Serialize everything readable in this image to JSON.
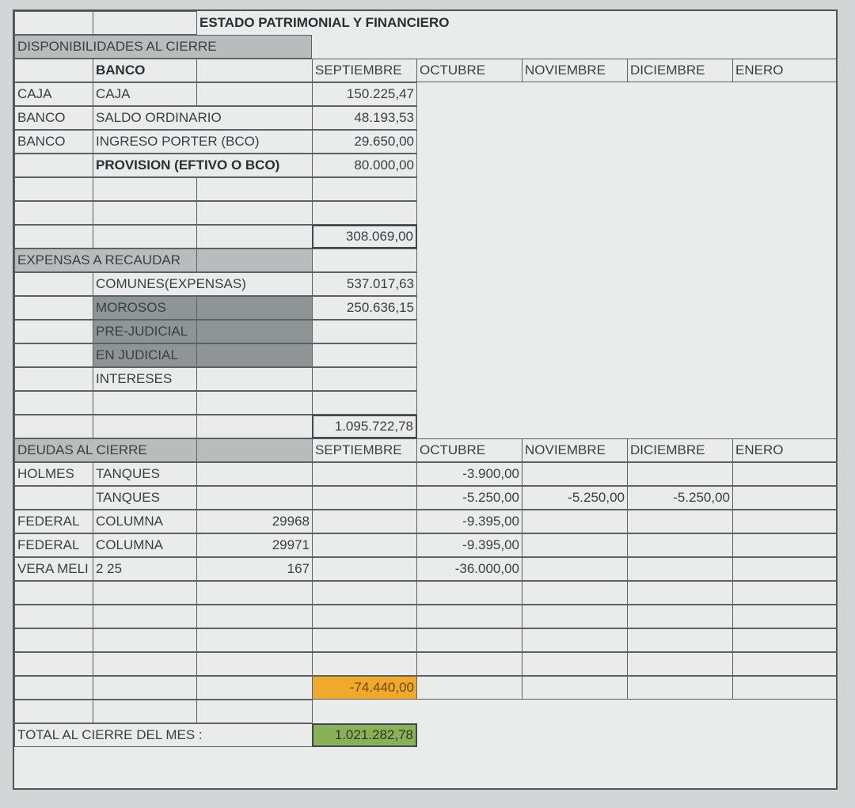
{
  "title": "ESTADO PATRIMONIAL Y FINANCIERO",
  "disponibilidades": {
    "header": "DISPONIBILIDADES AL CIERRE",
    "subheader": "BANCO",
    "months": [
      "SEPTIEMBRE",
      "OCTUBRE",
      "NOVIEMBRE",
      "DICIEMBRE",
      "ENERO"
    ],
    "rows": [
      {
        "type": "CAJA",
        "concept": "CAJA",
        "septiembre": "150.225,47"
      },
      {
        "type": "BANCO",
        "concept": "SALDO ORDINARIO",
        "septiembre": "48.193,53"
      },
      {
        "type": "BANCO",
        "concept": "INGRESO PORTER (BCO)",
        "septiembre": "29.650,00"
      },
      {
        "type": "",
        "concept": "PROVISION (EFTIVO O BCO)",
        "septiembre": "80.000,00"
      }
    ],
    "total": "308.069,00"
  },
  "expensas": {
    "header": "EXPENSAS A RECAUDAR",
    "rows": [
      {
        "concept": "COMUNES(EXPENSAS)",
        "septiembre": "537.017,63"
      },
      {
        "concept": "MOROSOS",
        "septiembre": "250.636,15"
      },
      {
        "concept": "PRE-JUDICIAL",
        "septiembre": ""
      },
      {
        "concept": "EN JUDICIAL",
        "septiembre": ""
      },
      {
        "concept": "INTERESES",
        "septiembre": ""
      }
    ],
    "total": "1.095.722,78"
  },
  "deudas": {
    "header": "DEUDAS AL CIERRE",
    "months": [
      "SEPTIEMBRE",
      "OCTUBRE",
      "NOVIEMBRE",
      "DICIEMBRE",
      "ENERO"
    ],
    "rows": [
      {
        "type": "HOLMES",
        "concept": "TANQUES",
        "ref": "",
        "septiembre": "",
        "octubre": "-3.900,00",
        "noviembre": "",
        "diciembre": "",
        "enero": ""
      },
      {
        "type": "",
        "concept": "TANQUES",
        "ref": "",
        "septiembre": "",
        "octubre": "-5.250,00",
        "noviembre": "-5.250,00",
        "diciembre": "-5.250,00",
        "enero": ""
      },
      {
        "type": "FEDERAL",
        "concept": "COLUMNA",
        "ref": "29968",
        "septiembre": "",
        "octubre": "-9.395,00",
        "noviembre": "",
        "diciembre": "",
        "enero": ""
      },
      {
        "type": "FEDERAL",
        "concept": "COLUMNA",
        "ref": "29971",
        "septiembre": "",
        "octubre": "-9.395,00",
        "noviembre": "",
        "diciembre": "",
        "enero": ""
      },
      {
        "type": "VERA MELI",
        "concept": "2 25",
        "ref": "167",
        "septiembre": "",
        "octubre": "-36.000,00",
        "noviembre": "",
        "diciembre": "",
        "enero": ""
      }
    ],
    "total": "-74.440,00"
  },
  "footer": {
    "label": "TOTAL AL CIERRE DEL MES :",
    "value": "1.021.282,78"
  }
}
